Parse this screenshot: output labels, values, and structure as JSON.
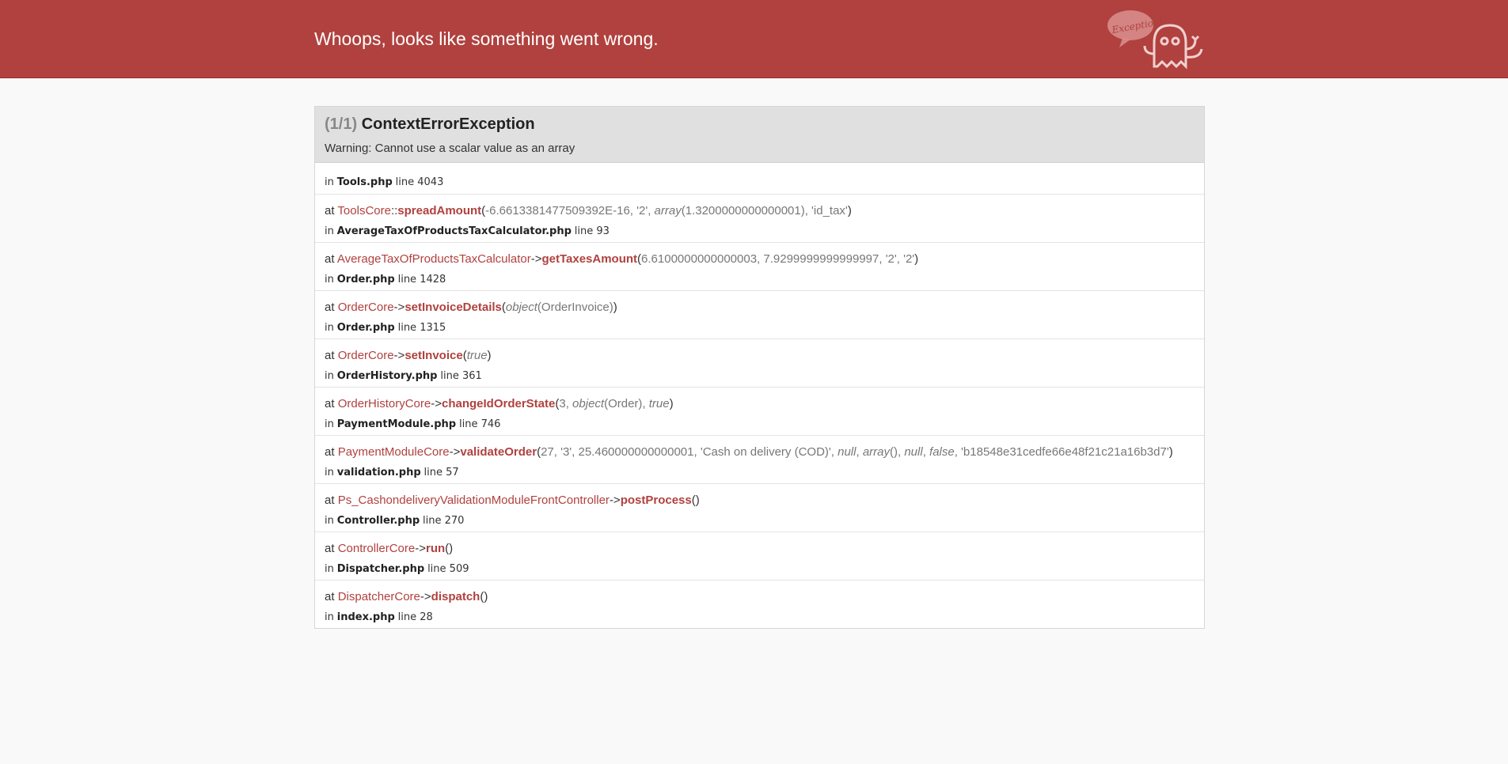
{
  "header": {
    "title": "Whoops, looks like something went wrong.",
    "logo_text": "Exception!"
  },
  "exception": {
    "count": "(1/1)",
    "class": "ContextErrorException",
    "message": "Warning: Cannot use a scalar value as an array"
  },
  "labels": {
    "at": "at",
    "in": "in",
    "line": "line"
  },
  "origin": {
    "file": "Tools.php",
    "line": "4043"
  },
  "trace": [
    {
      "class": "ToolsCore",
      "sep": "::",
      "method": "spreadAmount",
      "args_html": "-6.6613381477509392E-16, '2', <i>array</i>(1.3200000000000001), 'id_tax'",
      "file": "AverageTaxOfProductsTaxCalculator.php",
      "line": "93"
    },
    {
      "class": "AverageTaxOfProductsTaxCalculator",
      "sep": "->",
      "method": "getTaxesAmount",
      "args_html": "6.6100000000000003, 7.9299999999999997, '2', '2'",
      "file": "Order.php",
      "line": "1428"
    },
    {
      "class": "OrderCore",
      "sep": "->",
      "method": "setInvoiceDetails",
      "args_html": "<i>object</i>(OrderInvoice)",
      "file": "Order.php",
      "line": "1315"
    },
    {
      "class": "OrderCore",
      "sep": "->",
      "method": "setInvoice",
      "args_html": "<i>true</i>",
      "file": "OrderHistory.php",
      "line": "361"
    },
    {
      "class": "OrderHistoryCore",
      "sep": "->",
      "method": "changeIdOrderState",
      "args_html": "3, <i>object</i>(Order), <i>true</i>",
      "file": "PaymentModule.php",
      "line": "746"
    },
    {
      "class": "PaymentModuleCore",
      "sep": "->",
      "method": "validateOrder",
      "args_html": "27, '3', 25.460000000000001, 'Cash on delivery (COD)', <i>null</i>, <i>array</i>(), <i>null</i>, <i>false</i>, 'b18548e31cedfe66e48f21c21a16b3d7'",
      "file": "validation.php",
      "line": "57"
    },
    {
      "class": "Ps_CashondeliveryValidationModuleFrontController",
      "sep": "->",
      "method": "postProcess",
      "args_html": "",
      "file": "Controller.php",
      "line": "270"
    },
    {
      "class": "ControllerCore",
      "sep": "->",
      "method": "run",
      "args_html": "",
      "file": "Dispatcher.php",
      "line": "509"
    },
    {
      "class": "DispatcherCore",
      "sep": "->",
      "method": "dispatch",
      "args_html": "",
      "file": "index.php",
      "line": "28"
    }
  ]
}
